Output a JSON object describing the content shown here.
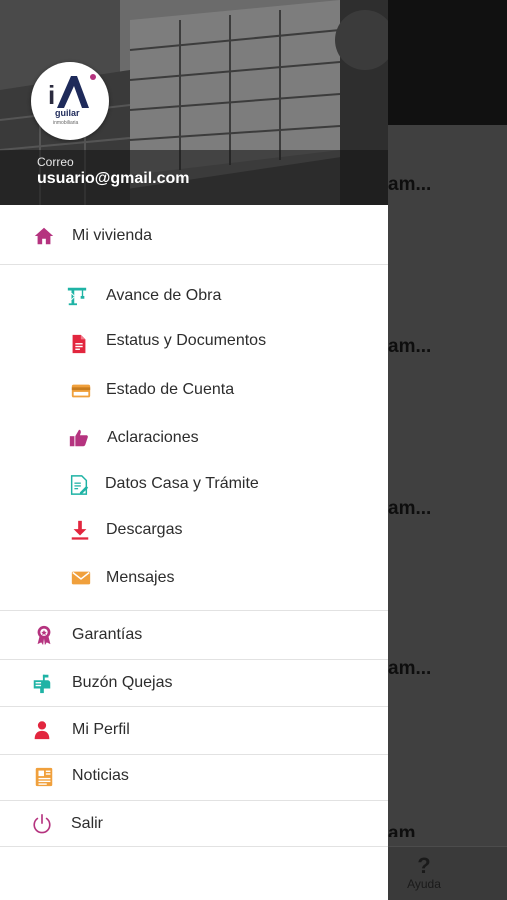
{
  "header": {
    "email_label": "Correo",
    "email": "usuario@gmail.com",
    "logo_text": "Aguilar Inmobiliaria"
  },
  "menu": {
    "main": {
      "label": "Mi vivienda",
      "icon": "home-icon",
      "color": "#b5337f"
    },
    "sub_items": [
      {
        "label": "Avance de Obra",
        "icon": "crane-icon",
        "color": "#1fb3a5"
      },
      {
        "label": "Estatus y Documentos",
        "icon": "document-icon",
        "color": "#e2263e"
      },
      {
        "label": "Estado de Cuenta",
        "icon": "credit-card-icon",
        "color": "#f0a03c"
      },
      {
        "label": "Aclaraciones",
        "icon": "thumbs-up-icon",
        "color": "#b5337f"
      },
      {
        "label": "Datos Casa y Trámite",
        "icon": "form-icon",
        "color": "#1fb3a5"
      },
      {
        "label": "Descargas",
        "icon": "download-icon",
        "color": "#e2263e"
      },
      {
        "label": "Mensajes",
        "icon": "mail-icon",
        "color": "#f0a03c"
      }
    ],
    "items": [
      {
        "label": "Garantías",
        "icon": "award-icon",
        "color": "#b5337f"
      },
      {
        "label": "Buzón Quejas",
        "icon": "mailbox-icon",
        "color": "#1fb3a5"
      },
      {
        "label": "Mi Perfil",
        "icon": "person-icon",
        "color": "#e2263e"
      },
      {
        "label": "Noticias",
        "icon": "newspaper-icon",
        "color": "#f0a03c"
      },
      {
        "label": "Salir",
        "icon": "power-icon",
        "color": "#b5337f"
      }
    ]
  },
  "background": {
    "row_texts": [
      "am...",
      "am...",
      "am...",
      "am...",
      "am"
    ],
    "help_label": "Ayuda",
    "help_icon": "?"
  }
}
